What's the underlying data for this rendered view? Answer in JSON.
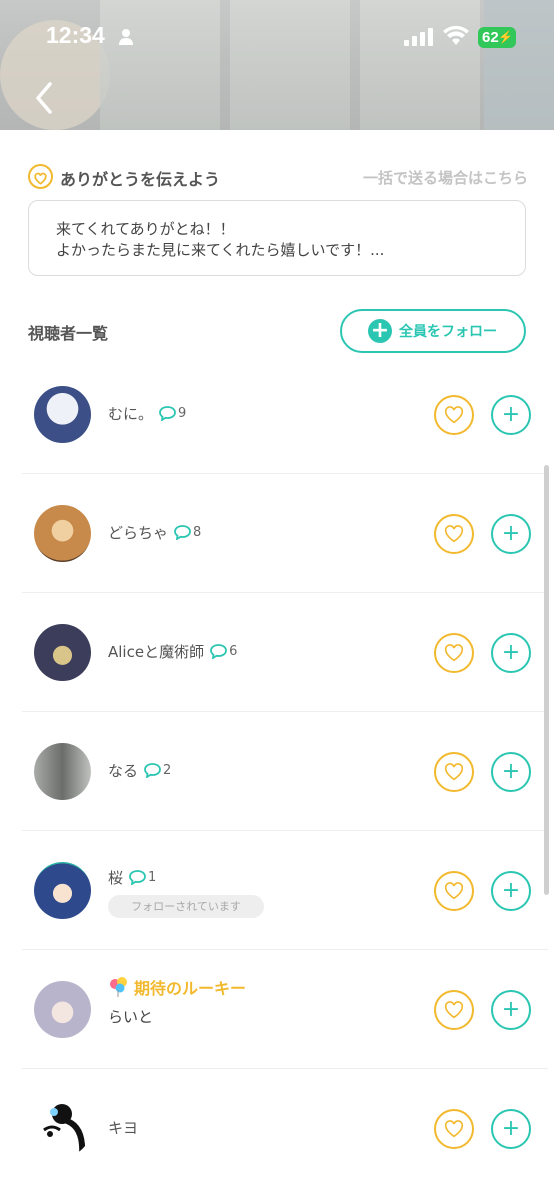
{
  "status_bar": {
    "time": "12:34",
    "battery": "62",
    "colors": {
      "battery": "#32c759"
    }
  },
  "thanks": {
    "title": "ありがとうを伝えよう",
    "bulk_link": "一括で送る場合はこちら",
    "message_line1": "来てくれてありがとね！！",
    "message_line2": "よかったらまた見に来てくれたら嬉しいです！..."
  },
  "viewers": {
    "title": "視聴者一覧",
    "follow_all_label": "全員をフォロー",
    "followed_badge_text": "フォローされています",
    "rookie_label": "期待のルーキー",
    "items": [
      {
        "name": "むに。",
        "comments": "9",
        "avatar_color": "#dbe3f0"
      },
      {
        "name": "どらちゃ",
        "comments": "8",
        "avatar_color": "#c88a4a"
      },
      {
        "name": "Aliceと魔術師",
        "comments": "6",
        "avatar_color": "#3b3d5a"
      },
      {
        "name": "なる",
        "comments": "2",
        "avatar_color": "#8d8f8c"
      },
      {
        "name": "桜",
        "comments": "1",
        "avatar_color": "#2e4a8c",
        "followed": true
      },
      {
        "name": "らいと",
        "avatar_color": "#b8b4cc",
        "rookie": true
      },
      {
        "name": "キヨ",
        "avatar_color": "#ffffff"
      }
    ]
  },
  "colors": {
    "accent_teal": "#2bc6b2",
    "accent_yellow": "#f2b92e"
  }
}
